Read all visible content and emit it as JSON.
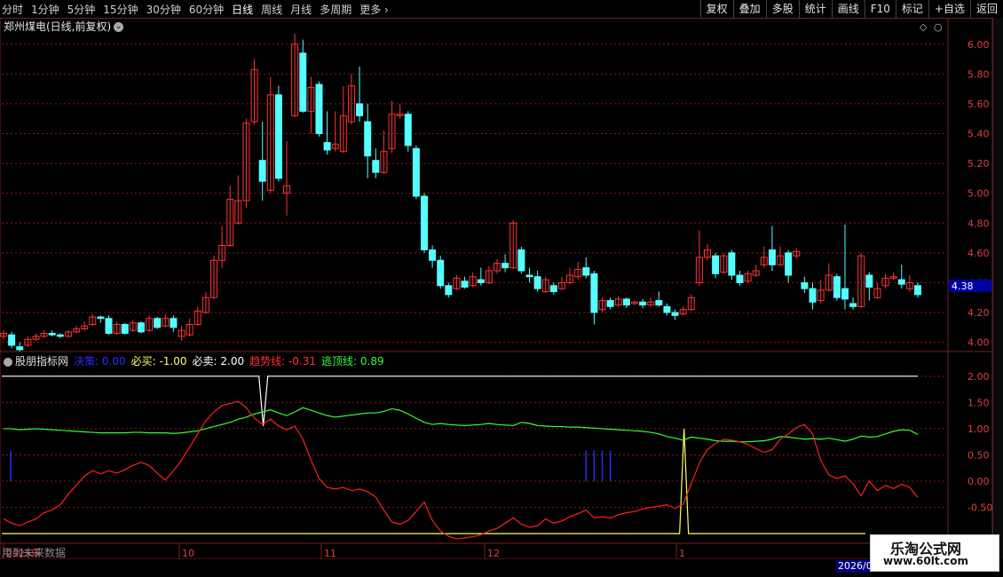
{
  "toolbar": {
    "periods": [
      "分时",
      "1分钟",
      "5分钟",
      "15分钟",
      "30分钟",
      "60分钟",
      "日线",
      "周线",
      "月线",
      "多周期",
      "更多"
    ],
    "active_period": "日线",
    "right_buttons": [
      "复权",
      "叠加",
      "多股",
      "统计",
      "画线",
      "F10",
      "标记",
      "+自选",
      "返回"
    ]
  },
  "stock": {
    "title": "郑州煤电(日线,前复权)",
    "price_tag": "4.38",
    "price_axis": [
      "6.00",
      "5.80",
      "5.60",
      "5.40",
      "5.20",
      "5.00",
      "4.80",
      "4.60",
      "4.40",
      "4.20",
      "4.00"
    ]
  },
  "indicator": {
    "name": "股朋指标网",
    "fields": [
      {
        "label": "决策:",
        "value": "0.00",
        "color": "#2a2aff"
      },
      {
        "label": "必买:",
        "value": "-1.00",
        "color": "#ffff66"
      },
      {
        "label": "必卖:",
        "value": "2.00",
        "color": "#ffffff"
      },
      {
        "label": "趋势线:",
        "value": "-0.31",
        "color": "#ff3333"
      },
      {
        "label": "逃顶线:",
        "value": "0.89",
        "color": "#33ff33"
      }
    ],
    "axis": [
      "2.00",
      "1.50",
      "1.00",
      "0.50",
      "0.00",
      "-0.50"
    ]
  },
  "time_axis": [
    "2025年",
    "10",
    "11",
    "12",
    "1"
  ],
  "year_badge": "2026/0",
  "bottom_note": "用到未来数据",
  "watermark": {
    "line1": "乐淘公式网",
    "line2": "www.60lt.com"
  },
  "colors": {
    "up": "#ff3232",
    "down": "#54ffff",
    "grid": "#8b1a1a",
    "trend": "#ff2020",
    "escape": "#33ff33",
    "decision": "#2a2aff",
    "buy": "#ffff66",
    "sell": "#ffffff"
  },
  "chart_data": [
    {
      "type": "candlestick",
      "title": "郑州煤电(日线,前复权)",
      "ylim": [
        3.95,
        6.07
      ],
      "candles": [
        [
          4.04,
          4.06,
          4.02,
          4.08
        ],
        [
          4.05,
          3.98,
          3.96,
          4.07
        ],
        [
          3.97,
          3.95,
          3.94,
          4.0
        ],
        [
          3.98,
          4.02,
          3.97,
          4.04
        ],
        [
          4.02,
          4.04,
          4.01,
          4.06
        ],
        [
          4.04,
          4.06,
          4.03,
          4.08
        ],
        [
          4.06,
          4.05,
          4.04,
          4.08
        ],
        [
          4.05,
          4.04,
          4.03,
          4.06
        ],
        [
          4.04,
          4.07,
          4.03,
          4.08
        ],
        [
          4.07,
          4.09,
          4.06,
          4.11
        ],
        [
          4.09,
          4.11,
          4.08,
          4.14
        ],
        [
          4.12,
          4.17,
          4.11,
          4.19
        ],
        [
          4.17,
          4.16,
          4.13,
          4.18
        ],
        [
          4.16,
          4.06,
          4.05,
          4.18
        ],
        [
          4.06,
          4.12,
          4.05,
          4.14
        ],
        [
          4.12,
          4.06,
          4.05,
          4.13
        ],
        [
          4.08,
          4.13,
          4.07,
          4.15
        ],
        [
          4.13,
          4.07,
          4.06,
          4.14
        ],
        [
          4.08,
          4.16,
          4.07,
          4.18
        ],
        [
          4.16,
          4.1,
          4.09,
          4.17
        ],
        [
          4.11,
          4.16,
          4.1,
          4.19
        ],
        [
          4.16,
          4.1,
          4.07,
          4.18
        ],
        [
          4.04,
          4.08,
          4.01,
          4.11
        ],
        [
          4.05,
          4.12,
          4.04,
          4.16
        ],
        [
          4.12,
          4.21,
          4.11,
          4.24
        ],
        [
          4.2,
          4.3,
          4.19,
          4.34
        ],
        [
          4.3,
          4.55,
          4.29,
          4.58
        ],
        [
          4.55,
          4.65,
          4.5,
          4.78
        ],
        [
          4.65,
          4.96,
          4.64,
          5.05
        ],
        [
          4.8,
          4.95,
          4.79,
          5.12
        ],
        [
          4.95,
          5.47,
          4.9,
          5.5
        ],
        [
          5.48,
          5.83,
          5.46,
          5.9
        ],
        [
          5.22,
          5.08,
          4.95,
          5.48
        ],
        [
          5.02,
          5.66,
          5.0,
          5.78
        ],
        [
          5.66,
          5.1,
          5.08,
          5.72
        ],
        [
          5.0,
          5.05,
          4.85,
          5.35
        ],
        [
          5.52,
          6.0,
          5.51,
          6.07
        ],
        [
          5.94,
          5.55,
          5.54,
          6.03
        ],
        [
          5.55,
          5.71,
          5.4,
          5.78
        ],
        [
          5.73,
          5.4,
          5.38,
          5.75
        ],
        [
          5.34,
          5.29,
          5.26,
          5.55
        ],
        [
          5.3,
          5.33,
          5.28,
          5.55
        ],
        [
          5.28,
          5.52,
          5.27,
          5.72
        ],
        [
          5.48,
          5.72,
          5.46,
          5.8
        ],
        [
          5.6,
          5.52,
          5.48,
          5.85
        ],
        [
          5.48,
          5.25,
          5.1,
          5.6
        ],
        [
          5.22,
          5.14,
          5.1,
          5.3
        ],
        [
          5.14,
          5.28,
          5.13,
          5.42
        ],
        [
          5.3,
          5.53,
          5.27,
          5.62
        ],
        [
          5.52,
          5.53,
          5.5,
          5.6
        ],
        [
          5.53,
          5.32,
          5.28,
          5.55
        ],
        [
          5.3,
          4.98,
          4.96,
          5.32
        ],
        [
          4.98,
          4.62,
          4.6,
          5.0
        ],
        [
          4.62,
          4.55,
          4.5,
          4.65
        ],
        [
          4.55,
          4.38,
          4.36,
          4.58
        ],
        [
          4.38,
          4.32,
          4.3,
          4.4
        ],
        [
          4.36,
          4.43,
          4.35,
          4.45
        ],
        [
          4.41,
          4.37,
          4.36,
          4.44
        ],
        [
          4.38,
          4.44,
          4.37,
          4.47
        ],
        [
          4.42,
          4.4,
          4.38,
          4.5
        ],
        [
          4.4,
          4.48,
          4.39,
          4.51
        ],
        [
          4.48,
          4.53,
          4.46,
          4.56
        ],
        [
          4.53,
          4.5,
          4.47,
          4.59
        ],
        [
          4.5,
          4.8,
          4.49,
          4.82
        ],
        [
          4.62,
          4.48,
          4.46,
          4.64
        ],
        [
          4.45,
          4.44,
          4.4,
          4.5
        ],
        [
          4.44,
          4.36,
          4.34,
          4.48
        ],
        [
          4.34,
          4.42,
          4.33,
          4.44
        ],
        [
          4.38,
          4.34,
          4.32,
          4.4
        ],
        [
          4.36,
          4.4,
          4.35,
          4.44
        ],
        [
          4.4,
          4.45,
          4.39,
          4.5
        ],
        [
          4.44,
          4.49,
          4.42,
          4.54
        ],
        [
          4.5,
          4.45,
          4.43,
          4.57
        ],
        [
          4.46,
          4.2,
          4.12,
          4.48
        ],
        [
          4.22,
          4.28,
          4.2,
          4.3
        ],
        [
          4.28,
          4.24,
          4.22,
          4.3
        ],
        [
          4.25,
          4.29,
          4.24,
          4.31
        ],
        [
          4.29,
          4.25,
          4.23,
          4.3
        ],
        [
          4.26,
          4.27,
          4.25,
          4.28
        ],
        [
          4.27,
          4.25,
          4.23,
          4.29
        ],
        [
          4.25,
          4.27,
          4.24,
          4.3
        ],
        [
          4.28,
          4.25,
          4.24,
          4.34
        ],
        [
          4.24,
          4.2,
          4.18,
          4.26
        ],
        [
          4.2,
          4.18,
          4.15,
          4.22
        ],
        [
          4.19,
          4.22,
          4.18,
          4.24
        ],
        [
          4.22,
          4.3,
          4.21,
          4.32
        ],
        [
          4.4,
          4.57,
          4.38,
          4.75
        ],
        [
          4.57,
          4.62,
          4.55,
          4.66
        ],
        [
          4.58,
          4.46,
          4.43,
          4.6
        ],
        [
          4.47,
          4.58,
          4.46,
          4.6
        ],
        [
          4.6,
          4.45,
          4.42,
          4.62
        ],
        [
          4.45,
          4.4,
          4.38,
          4.48
        ],
        [
          4.41,
          4.46,
          4.4,
          4.48
        ],
        [
          4.45,
          4.48,
          4.44,
          4.52
        ],
        [
          4.52,
          4.57,
          4.5,
          4.64
        ],
        [
          4.62,
          4.52,
          4.48,
          4.78
        ],
        [
          4.52,
          4.58,
          4.51,
          4.64
        ],
        [
          4.6,
          4.45,
          4.4,
          4.62
        ],
        [
          4.58,
          4.61,
          4.56,
          4.63
        ],
        [
          4.4,
          4.36,
          4.33,
          4.44
        ],
        [
          4.36,
          4.27,
          4.22,
          4.4
        ],
        [
          4.28,
          4.35,
          4.26,
          4.42
        ],
        [
          4.35,
          4.45,
          4.34,
          4.53
        ],
        [
          4.44,
          4.3,
          4.28,
          4.46
        ],
        [
          4.36,
          4.29,
          4.22,
          4.79
        ],
        [
          4.26,
          4.24,
          4.22,
          4.3
        ],
        [
          4.24,
          4.58,
          4.23,
          4.6
        ],
        [
          4.45,
          4.37,
          4.28,
          4.47
        ],
        [
          4.3,
          4.36,
          4.29,
          4.4
        ],
        [
          4.38,
          4.43,
          4.36,
          4.46
        ],
        [
          4.43,
          4.44,
          4.42,
          4.47
        ],
        [
          4.42,
          4.39,
          4.36,
          4.52
        ],
        [
          4.36,
          4.4,
          4.34,
          4.45
        ],
        [
          4.38,
          4.32,
          4.3,
          4.4
        ]
      ],
      "last_price": 4.38
    },
    {
      "type": "line",
      "title": "股朋指标网",
      "ylim": [
        -1.15,
        2.2
      ],
      "series": [
        {
          "name": "趋势线",
          "values": [
            -0.72,
            -0.8,
            -0.85,
            -0.78,
            -0.72,
            -0.6,
            -0.55,
            -0.45,
            -0.25,
            -0.08,
            0.1,
            0.2,
            0.14,
            0.2,
            0.15,
            0.22,
            0.3,
            0.36,
            0.3,
            0.15,
            0.02,
            0.2,
            0.4,
            0.65,
            0.9,
            1.15,
            1.32,
            1.44,
            1.48,
            1.52,
            1.4,
            1.2,
            1.08,
            1.18,
            1.05,
            0.98,
            1.05,
            0.8,
            0.4,
            0.05,
            -0.12,
            -0.15,
            -0.12,
            -0.18,
            -0.15,
            -0.2,
            -0.3,
            -0.55,
            -0.78,
            -0.82,
            -0.75,
            -0.58,
            -0.4,
            -0.75,
            -0.95,
            -1.05,
            -1.1,
            -1.08,
            -1.06,
            -1.02,
            -0.95,
            -0.9,
            -0.8,
            -0.7,
            -0.82,
            -0.88,
            -0.85,
            -0.72,
            -0.8,
            -0.76,
            -0.68,
            -0.62,
            -0.55,
            -0.7,
            -0.68,
            -0.7,
            -0.64,
            -0.6,
            -0.58,
            -0.53,
            -0.5,
            -0.48,
            -0.45,
            -0.52,
            -0.44,
            -0.05,
            0.35,
            0.6,
            0.72,
            0.8,
            0.78,
            0.75,
            0.7,
            0.62,
            0.55,
            0.6,
            0.8,
            0.9,
            1.02,
            1.08,
            0.9,
            0.4,
            0.12,
            0.05,
            0.1,
            -0.05,
            -0.28,
            -0.0,
            -0.18,
            -0.08,
            -0.14,
            -0.06,
            -0.12,
            -0.31
          ]
        },
        {
          "name": "逃顶线",
          "values": [
            1.0,
            1.0,
            0.98,
            0.99,
            1.0,
            0.99,
            0.98,
            0.97,
            0.96,
            0.95,
            0.94,
            0.93,
            0.92,
            0.92,
            0.92,
            0.92,
            0.93,
            0.93,
            0.92,
            0.92,
            0.92,
            0.91,
            0.92,
            0.94,
            0.96,
            1.0,
            1.04,
            1.08,
            1.12,
            1.18,
            1.22,
            1.28,
            1.32,
            1.36,
            1.3,
            1.25,
            1.32,
            1.4,
            1.35,
            1.3,
            1.25,
            1.22,
            1.24,
            1.26,
            1.28,
            1.3,
            1.3,
            1.33,
            1.38,
            1.35,
            1.28,
            1.2,
            1.12,
            1.08,
            1.1,
            1.08,
            1.07,
            1.06,
            1.07,
            1.08,
            1.1,
            1.08,
            1.07,
            1.06,
            1.12,
            1.1,
            1.06,
            1.05,
            1.04,
            1.04,
            1.03,
            1.03,
            1.02,
            1.01,
            1.0,
            0.99,
            0.98,
            0.97,
            0.96,
            0.95,
            0.93,
            0.9,
            0.85,
            0.82,
            0.78,
            0.84,
            0.82,
            0.8,
            0.77,
            0.76,
            0.76,
            0.75,
            0.75,
            0.76,
            0.77,
            0.8,
            0.85,
            0.84,
            0.82,
            0.8,
            0.81,
            0.8,
            0.82,
            0.79,
            0.76,
            0.8,
            0.86,
            0.84,
            0.85,
            0.9,
            0.95,
            0.98,
            0.97,
            0.89
          ]
        }
      ],
      "decision_markers": [
        0.0,
        85,
        86,
        87,
        88
      ],
      "buy_line": -1.0,
      "sell_line": 2.0
    }
  ]
}
